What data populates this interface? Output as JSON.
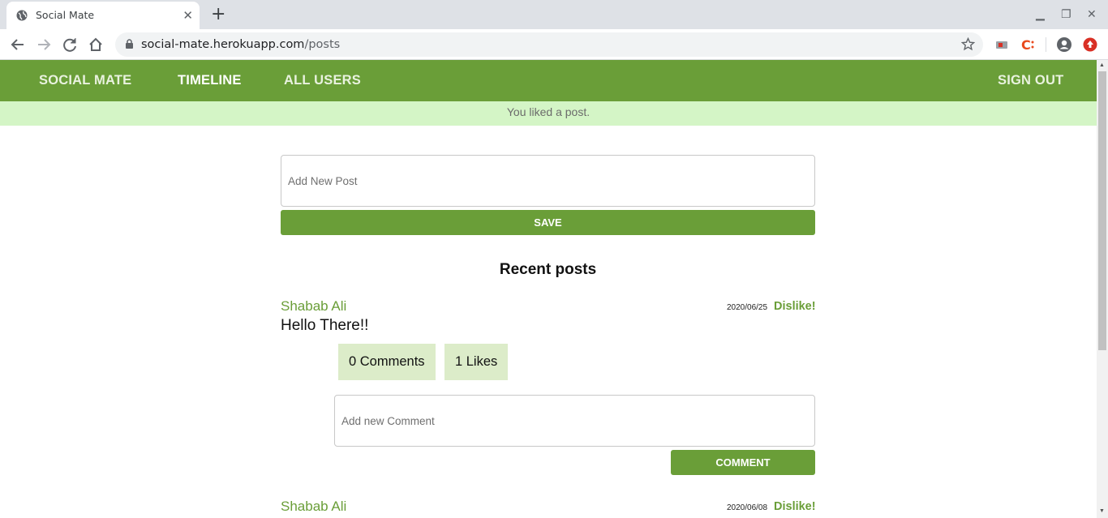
{
  "browser": {
    "tab_title": "Social Mate",
    "url_host": "social-mate.herokuapp.com",
    "url_path": "/posts"
  },
  "nav": {
    "brand": "SOCIAL MATE",
    "timeline": "TIMELINE",
    "all_users": "ALL USERS",
    "sign_out": "SIGN OUT"
  },
  "notice": "You liked a post.",
  "new_post": {
    "placeholder": "Add New Post",
    "save_label": "SAVE"
  },
  "recent_posts_title": "Recent posts",
  "posts": [
    {
      "author": "Shabab Ali",
      "date": "2020/06/25",
      "action": "Dislike!",
      "content": "Hello There!!",
      "comments": "0 Comments",
      "likes": "1 Likes",
      "comment_placeholder": "Add new Comment",
      "comment_label": "COMMENT"
    },
    {
      "author": "Shabab Ali",
      "date": "2020/06/08",
      "action": "Dislike!"
    }
  ],
  "colors": {
    "brand_green": "#6a9e38",
    "notice_bg": "#d4f5c6",
    "stat_bg": "#dcecc9"
  }
}
